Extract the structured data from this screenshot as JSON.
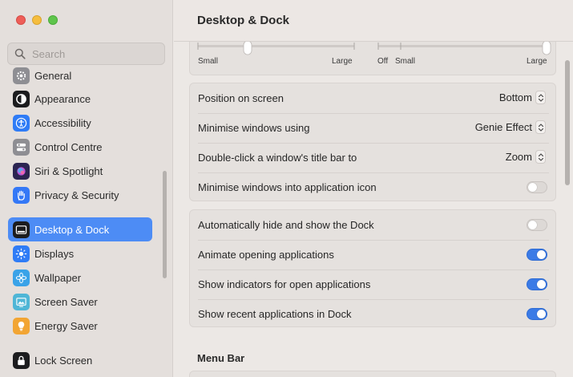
{
  "window": {
    "title": "Desktop & Dock"
  },
  "search": {
    "placeholder": "Search"
  },
  "sidebar": {
    "items": [
      {
        "label": "General",
        "icon": "gear-icon",
        "color": "#8e8e93"
      },
      {
        "label": "Appearance",
        "icon": "appearance-icon",
        "color": "#1c1c1e"
      },
      {
        "label": "Accessibility",
        "icon": "accessibility-icon",
        "color": "#2f7cf6"
      },
      {
        "label": "Control Centre",
        "icon": "control-centre-icon",
        "color": "#8e8e93"
      },
      {
        "label": "Siri & Spotlight",
        "icon": "siri-icon",
        "color": "#4b3a9c"
      },
      {
        "label": "Privacy & Security",
        "icon": "hand-icon",
        "color": "#3478f6"
      },
      {
        "label": "Desktop & Dock",
        "icon": "dock-icon",
        "color": "#1c1c1e",
        "selected": true
      },
      {
        "label": "Displays",
        "icon": "sun-icon",
        "color": "#2f7cf6"
      },
      {
        "label": "Wallpaper",
        "icon": "flower-icon",
        "color": "#3aa3e8"
      },
      {
        "label": "Screen Saver",
        "icon": "screensaver-icon",
        "color": "#4fb6d6"
      },
      {
        "label": "Energy Saver",
        "icon": "bulb-icon",
        "color": "#f2a533"
      },
      {
        "label": "Lock Screen",
        "icon": "lock-icon",
        "color": "#1c1c1e"
      }
    ]
  },
  "sliders": {
    "size": {
      "min_label": "Small",
      "max_label": "Large",
      "value": 0.2
    },
    "magnification": {
      "off_label": "Off",
      "min_label": "Small",
      "max_label": "Large",
      "value": 1.0
    }
  },
  "dock_settings": {
    "position": {
      "label": "Position on screen",
      "value": "Bottom"
    },
    "minimise_using": {
      "label": "Minimise windows using",
      "value": "Genie Effect"
    },
    "double_click": {
      "label": "Double-click a window's title bar to",
      "value": "Zoom"
    },
    "minimise_into_icon": {
      "label": "Minimise windows into application icon",
      "on": false
    }
  },
  "dock_toggles": {
    "autohide": {
      "label": "Automatically hide and show the Dock",
      "on": false
    },
    "animate": {
      "label": "Animate opening applications",
      "on": true
    },
    "indicators": {
      "label": "Show indicators for open applications",
      "on": true
    },
    "recent": {
      "label": "Show recent applications in Dock",
      "on": true
    }
  },
  "menu_bar": {
    "title": "Menu Bar"
  },
  "colors": {
    "accent": "#3b7be6",
    "selection": "#4d8cf5"
  }
}
